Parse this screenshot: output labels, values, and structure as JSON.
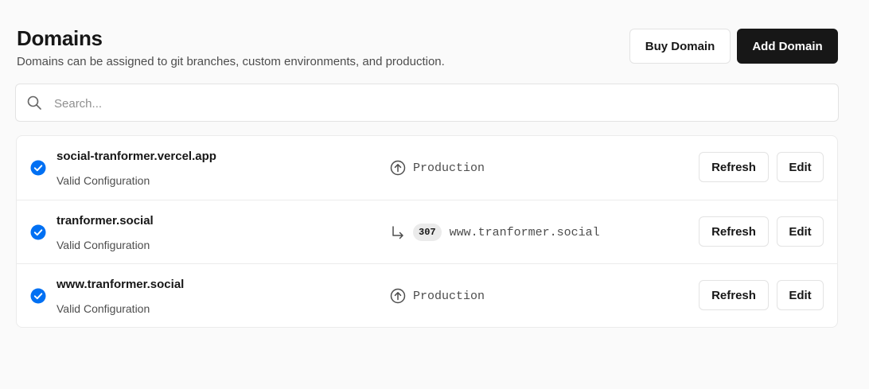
{
  "header": {
    "title": "Domains",
    "subtitle": "Domains can be assigned to git branches, custom environments, and production.",
    "buy_label": "Buy Domain",
    "add_label": "Add Domain"
  },
  "search": {
    "placeholder": "Search...",
    "value": ""
  },
  "domains": [
    {
      "name": "social-tranformer.vercel.app",
      "status": "Valid Configuration",
      "target_icon": "arrow-up-circle-icon",
      "target": "Production",
      "refresh_label": "Refresh",
      "edit_label": "Edit"
    },
    {
      "name": "tranformer.social",
      "status": "Valid Configuration",
      "target_icon": "redirect-arrow-icon",
      "redirect_code": "307",
      "target": "www.tranformer.social",
      "refresh_label": "Refresh",
      "edit_label": "Edit"
    },
    {
      "name": "www.tranformer.social",
      "status": "Valid Configuration",
      "target_icon": "arrow-up-circle-icon",
      "target": "Production",
      "refresh_label": "Refresh",
      "edit_label": "Edit"
    }
  ],
  "colors": {
    "accent_blue": "#0070f3",
    "primary_button": "#171717",
    "page_background": "#fafafa"
  }
}
